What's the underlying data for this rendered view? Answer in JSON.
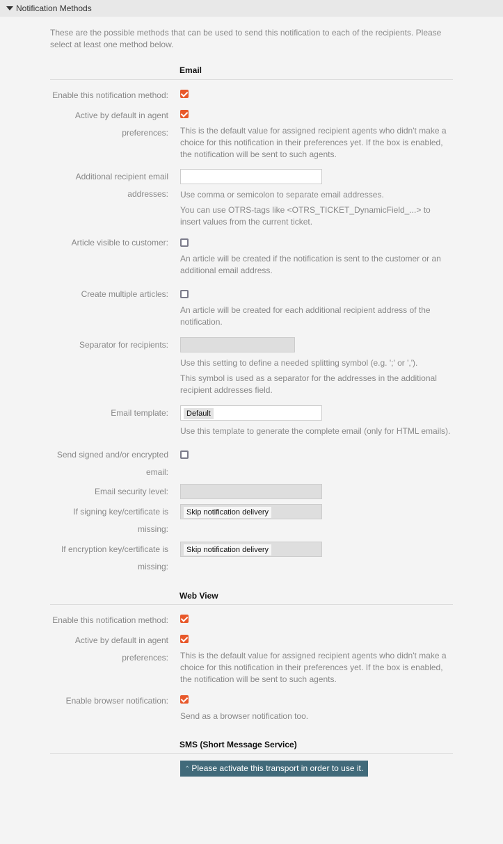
{
  "header": {
    "title": "Notification Methods",
    "icon": "caret-down-icon"
  },
  "intro": "These are the possible methods that can be used to send this notification to each of the recipients. Please select at least one method below.",
  "email": {
    "title": "Email",
    "enable_label": "Enable this notification method:",
    "enable_checked": true,
    "active_label": "Active by default in agent preferences:",
    "active_checked": true,
    "active_desc": "This is the default value for assigned recipient agents who didn't make a choice for this notification in their preferences yet. If the box is enabled, the notification will be sent to such agents.",
    "additional_label": "Additional recipient email addresses:",
    "additional_value": "",
    "additional_desc1": "Use comma or semicolon to separate email addresses.",
    "additional_desc2": "You can use OTRS-tags like <OTRS_TICKET_DynamicField_...> to insert values from the current ticket.",
    "visible_label": "Article visible to customer:",
    "visible_checked": false,
    "visible_desc": "An article will be created if the notification is sent to the customer or an additional email address.",
    "multiple_label": "Create multiple articles:",
    "multiple_checked": false,
    "multiple_desc": "An article will be created for each additional recipient address of the notification.",
    "separator_label": "Separator for recipients:",
    "separator_desc1": "Use this setting to define a needed splitting symbol (e.g. ';' or ',').",
    "separator_desc2": "This symbol is used as a separator for the addresses in the additional recipient addresses field.",
    "template_label": "Email template:",
    "template_value": "Default",
    "template_desc": "Use this template to generate the complete email (only for HTML emails).",
    "signed_label": "Send signed and/or encrypted email:",
    "signed_checked": false,
    "security_label": "Email security level:",
    "signing_label": "If signing key/certificate is missing:",
    "signing_value": "Skip notification delivery",
    "encryption_label": "If encryption key/certificate is missing:",
    "encryption_value": "Skip notification delivery"
  },
  "webview": {
    "title": "Web View",
    "enable_label": "Enable this notification method:",
    "enable_checked": true,
    "active_label": "Active by default in agent preferences:",
    "active_checked": true,
    "active_desc": "This is the default value for assigned recipient agents who didn't make a choice for this notification in their preferences yet. If the box is enabled, the notification will be sent to such agents.",
    "browser_label": "Enable browser notification:",
    "browser_checked": true,
    "browser_desc": "Send as a browser notification too."
  },
  "sms": {
    "title": "SMS (Short Message Service)",
    "activate_button": "Please activate this transport in order to use it.",
    "activate_icon": "double-chevron-up-icon"
  },
  "colors": {
    "accent": "#e8582a",
    "button": "#416a7a"
  }
}
